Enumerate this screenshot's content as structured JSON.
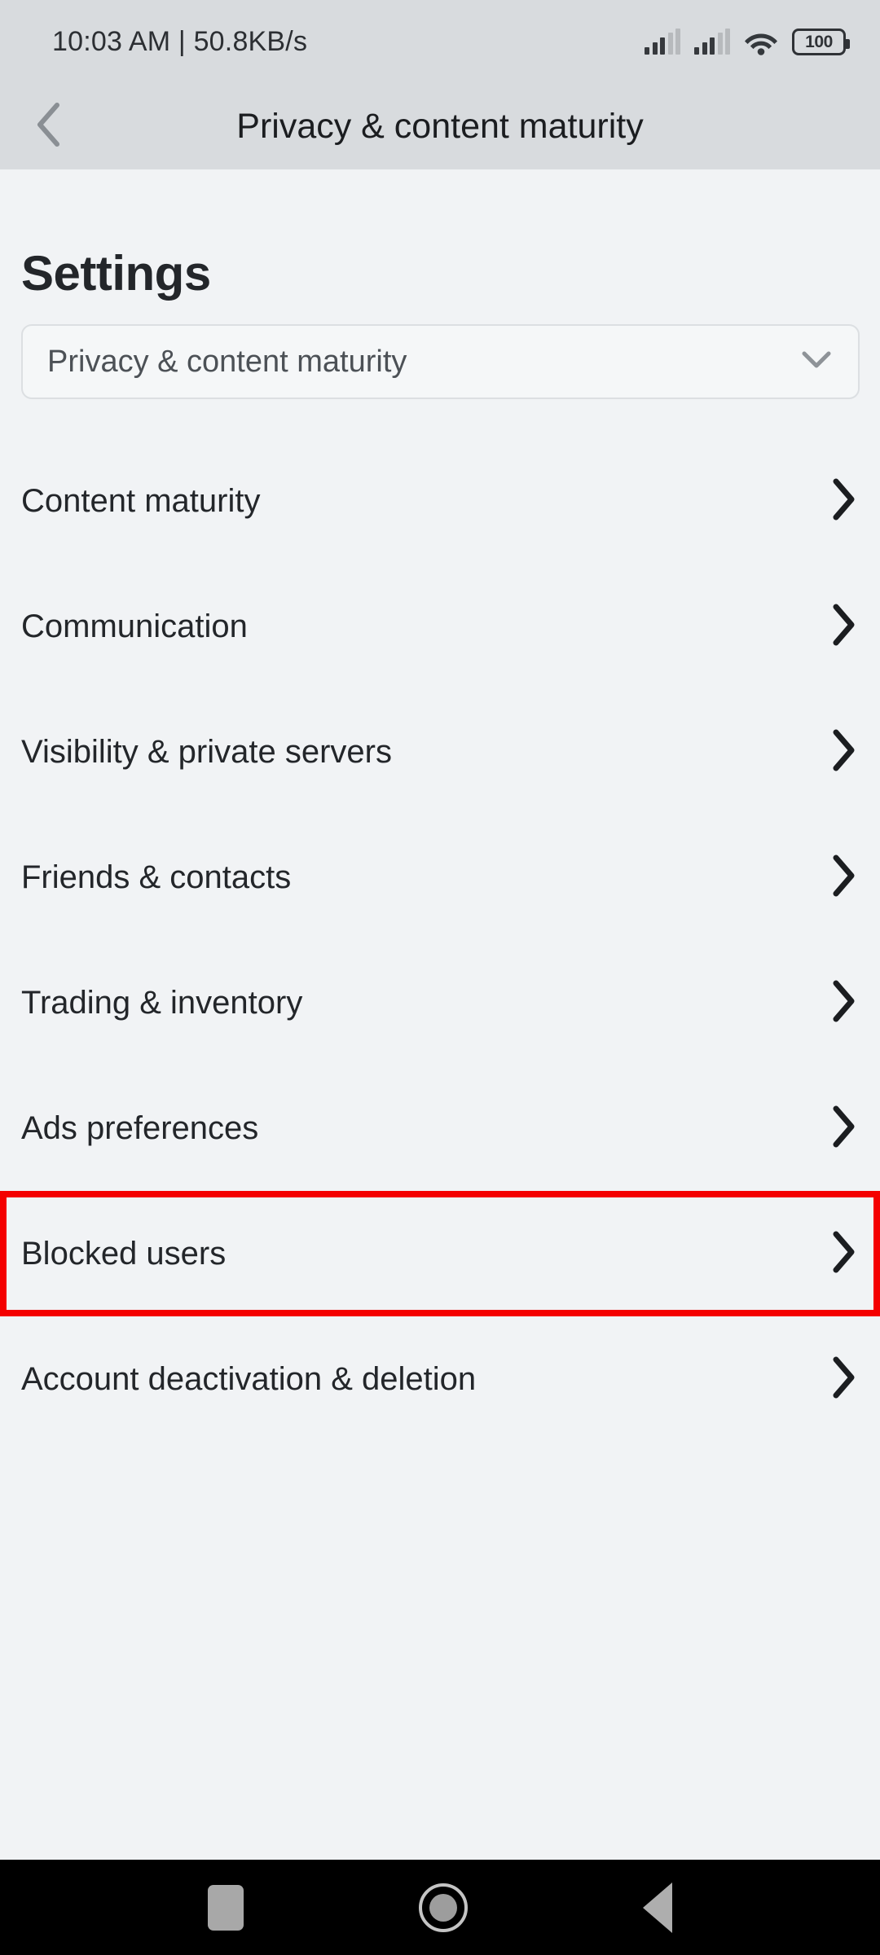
{
  "status_bar": {
    "time_and_network": "10:03 AM | 50.8KB/s",
    "signal_1_icon": "signal-bars-icon",
    "signal_2_icon": "signal-bars-icon",
    "wifi_icon": "wifi-icon",
    "battery_level": "100",
    "battery_icon": "battery-icon"
  },
  "app_bar": {
    "back_icon": "chevron-left-icon",
    "title": "Privacy & content maturity"
  },
  "page": {
    "title": "Settings"
  },
  "category_select": {
    "value": "Privacy & content maturity",
    "chevron_icon": "chevron-down-icon"
  },
  "settings_list": {
    "chevron_icon": "chevron-right-icon",
    "items": [
      {
        "label": "Content maturity",
        "highlighted": false
      },
      {
        "label": "Communication",
        "highlighted": false
      },
      {
        "label": "Visibility & private servers",
        "highlighted": false
      },
      {
        "label": "Friends & contacts",
        "highlighted": false
      },
      {
        "label": "Trading & inventory",
        "highlighted": false
      },
      {
        "label": "Ads preferences",
        "highlighted": false
      },
      {
        "label": "Blocked users",
        "highlighted": true
      },
      {
        "label": "Account deactivation & deletion",
        "highlighted": false
      }
    ]
  },
  "nav_bar": {
    "recents_icon": "square-recents-icon",
    "home_icon": "circle-home-icon",
    "back_icon": "triangle-back-icon"
  },
  "colors": {
    "highlight": "#f40000",
    "status_bar_bg": "#d8dbde",
    "content_bg": "#f1f3f5",
    "text": "#23262a"
  }
}
